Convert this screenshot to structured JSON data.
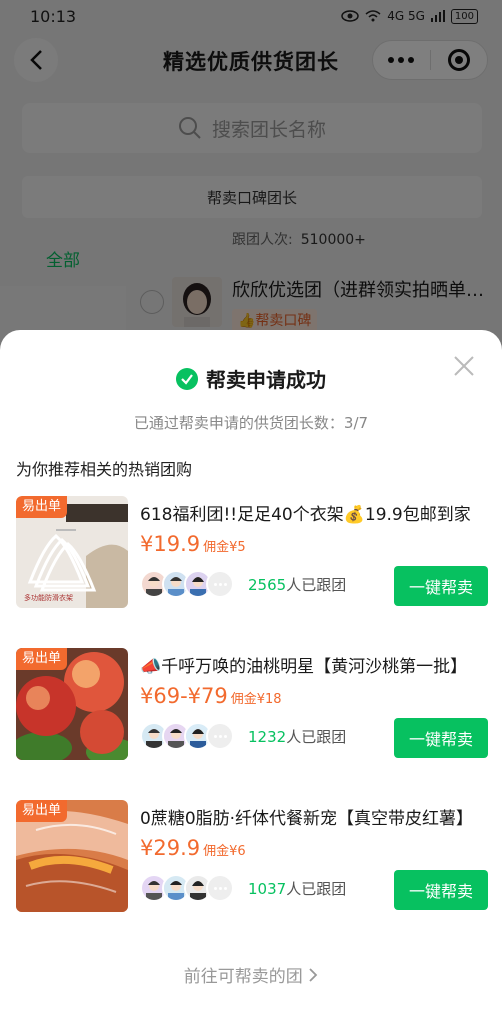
{
  "status_bar": {
    "time": "10:13",
    "network": "4G 5G",
    "battery": "100"
  },
  "nav": {
    "title": "精选优质供货团长"
  },
  "search": {
    "placeholder": "搜索团长名称"
  },
  "filter": {
    "reputation_label": "帮卖口碑团长"
  },
  "stats": {
    "follow_label": "跟团人次:",
    "follow_value": "510000+"
  },
  "tabs": {
    "all": "全部"
  },
  "leader": {
    "name": "欣欣优选团（进群领实拍晒单红包）",
    "tag": "👍帮卖口碑"
  },
  "sheet": {
    "title": "帮卖申请成功",
    "summary": "已通过帮卖申请的供货团长数：3/7",
    "section_title": "为你推荐相关的热销团购",
    "footer_link": "前往可帮卖的团",
    "accent_color": "#07c160",
    "price_color": "#f26a2e"
  },
  "products": [
    {
      "badge": "易出单",
      "title": "618福利团!!足足40个衣架💰19.9包邮到家",
      "price": "¥19.9",
      "commission": "佣金¥5",
      "joined_count": "2565",
      "joined_suffix": "人已跟团",
      "button": "一键帮卖",
      "thumb_text": "多功能防滑衣架"
    },
    {
      "badge": "易出单",
      "title": "📣千呼万唤的油桃明星【黄河沙桃第一批】",
      "price": "¥69-¥79",
      "commission": "佣金¥18",
      "joined_count": "1232",
      "joined_suffix": "人已跟团",
      "button": "一键帮卖"
    },
    {
      "badge": "易出单",
      "title": "0蔗糖0脂肪·纤体代餐新宠【真空带皮红薯】",
      "price": "¥29.9",
      "commission": "佣金¥6",
      "joined_count": "1037",
      "joined_suffix": "人已跟团",
      "button": "一键帮卖"
    }
  ]
}
